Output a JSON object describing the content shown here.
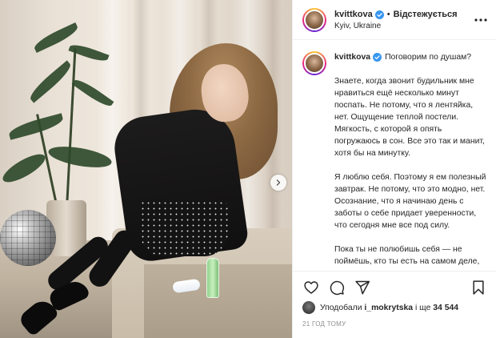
{
  "post": {
    "username": "kvittkova",
    "follow_status": "Відстежується",
    "separator": "•",
    "location": "Kyiv, Ukraine"
  },
  "caption": {
    "username": "kvittkova",
    "title": "Поговорим по душам?",
    "paragraphs": [
      "Знаете, когда звонит будильник мне нравиться ещё несколько минут поспать. Не потому, что я лентяйка, нет. Ощущение теплой постели. Мягкость, с которой я опять погружаюсь в сон. Все это так и манит, хотя бы на минутку.",
      "Я люблю себя. Поэтому я ем полезный завтрак. Не потому, что это модно, нет. Осознание, что я начинаю день с заботы о себе придает уверенности, что сегодня мне все под силу.",
      "Пока ты не полюбишь себя — не поймёшь, кто ты есть на самом деле, не узнаешь, на что я"
    ]
  },
  "likes": {
    "prefix": "Уподобали",
    "user": "i_mokrytska",
    "middle": "і ще",
    "count": "34 544"
  },
  "timestamp": "21 год тому",
  "icons": {
    "verified": "verified-badge-icon",
    "more": "more-options-icon",
    "next": "chevron-right-icon",
    "like": "heart-icon",
    "comment": "comment-icon",
    "share": "paper-plane-icon",
    "save": "bookmark-icon"
  },
  "colors": {
    "verified": "#3897f0",
    "text": "#262626",
    "muted": "#8e8e8e"
  }
}
